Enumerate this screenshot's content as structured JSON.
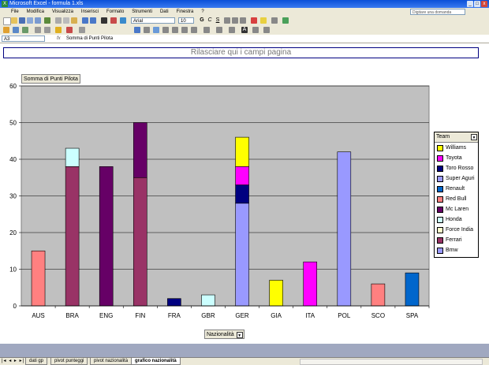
{
  "window": {
    "title": "Microsoft Excel - formula 1.xls",
    "app_icon": "excel-icon"
  },
  "menu": {
    "items": [
      "File",
      "Modifica",
      "Visualizza",
      "Inserisci",
      "Formato",
      "Strumenti",
      "Dati",
      "Finestra",
      "?"
    ],
    "help_placeholder": "Digitare una domanda"
  },
  "toolbar": {
    "font_name": "Arial",
    "font_size": "10"
  },
  "formula_bar": {
    "cell_ref": "A3",
    "fx": "fx",
    "value": "Somma di Punti Pilota"
  },
  "pivot": {
    "page_field_drop": "Rilasciare qui i campi pagina",
    "data_field": "Somma di Punti Pilota",
    "row_field": "Nazionalità",
    "legend_title": "Team"
  },
  "colors": {
    "plot_area": "#c0c0c0",
    "background": "#ffffff",
    "band": "#a0a8c0"
  },
  "chart_data": {
    "type": "bar",
    "stacked": true,
    "categories": [
      "AUS",
      "BRA",
      "ENG",
      "FIN",
      "FRA",
      "GBR",
      "GER",
      "GIA",
      "ITA",
      "POL",
      "SCO",
      "SPA"
    ],
    "ylim": [
      0,
      60
    ],
    "yticks": [
      0,
      10,
      20,
      30,
      40,
      50,
      60
    ],
    "title": "",
    "xlabel": "",
    "ylabel": "",
    "grid": true,
    "legend_position": "right",
    "series": [
      {
        "name": "Williams",
        "color": "#ffff00",
        "values": [
          0,
          0,
          0,
          0,
          0,
          0,
          8,
          7,
          0,
          0,
          0,
          0
        ]
      },
      {
        "name": "Toyota",
        "color": "#ff00ff",
        "values": [
          0,
          0,
          0,
          0,
          0,
          0,
          5,
          0,
          12,
          0,
          0,
          0
        ]
      },
      {
        "name": "Toro Rosso",
        "color": "#000080",
        "values": [
          0,
          0,
          0,
          0,
          2,
          0,
          5,
          0,
          0,
          0,
          0,
          0
        ]
      },
      {
        "name": "Super Aguri",
        "color": "#9999ff",
        "values": [
          0,
          0,
          0,
          0,
          0,
          0,
          0,
          0,
          0,
          0,
          0,
          0
        ]
      },
      {
        "name": "Renault",
        "color": "#0066cc",
        "values": [
          0,
          0,
          0,
          0,
          0,
          0,
          0,
          0,
          0,
          0,
          0,
          9
        ]
      },
      {
        "name": "Red Bull",
        "color": "#ff8080",
        "values": [
          15,
          0,
          0,
          0,
          0,
          0,
          0,
          0,
          0,
          0,
          6,
          0
        ]
      },
      {
        "name": "Mc Laren",
        "color": "#660066",
        "values": [
          0,
          0,
          38,
          15,
          0,
          0,
          0,
          0,
          0,
          0,
          0,
          0
        ]
      },
      {
        "name": "Honda",
        "color": "#ccffff",
        "values": [
          0,
          5,
          0,
          0,
          0,
          3,
          0,
          0,
          0,
          0,
          0,
          0
        ]
      },
      {
        "name": "Force India",
        "color": "#ffffcc",
        "values": [
          0,
          0,
          0,
          0,
          0,
          0,
          0,
          0,
          0,
          0,
          0,
          0
        ]
      },
      {
        "name": "Ferrari",
        "color": "#993366",
        "values": [
          0,
          38,
          0,
          35,
          0,
          0,
          0,
          0,
          0,
          0,
          0,
          0
        ]
      },
      {
        "name": "Bmw",
        "color": "#9999ff",
        "values": [
          0,
          0,
          0,
          0,
          0,
          0,
          28,
          0,
          0,
          42,
          0,
          0
        ]
      }
    ],
    "stack_order": [
      "Bmw",
      "Ferrari",
      "Force India",
      "Honda",
      "Mc Laren",
      "Red Bull",
      "Renault",
      "Super Aguri",
      "Toro Rosso",
      "Toyota",
      "Williams"
    ]
  },
  "sheets": {
    "nav": "|◂ ◂ ▸ ▸|",
    "tabs": [
      "dati gp",
      "pivot punteggi",
      "pivot nazionalità",
      "grafico nazionalità"
    ],
    "active": "grafico nazionalità"
  }
}
